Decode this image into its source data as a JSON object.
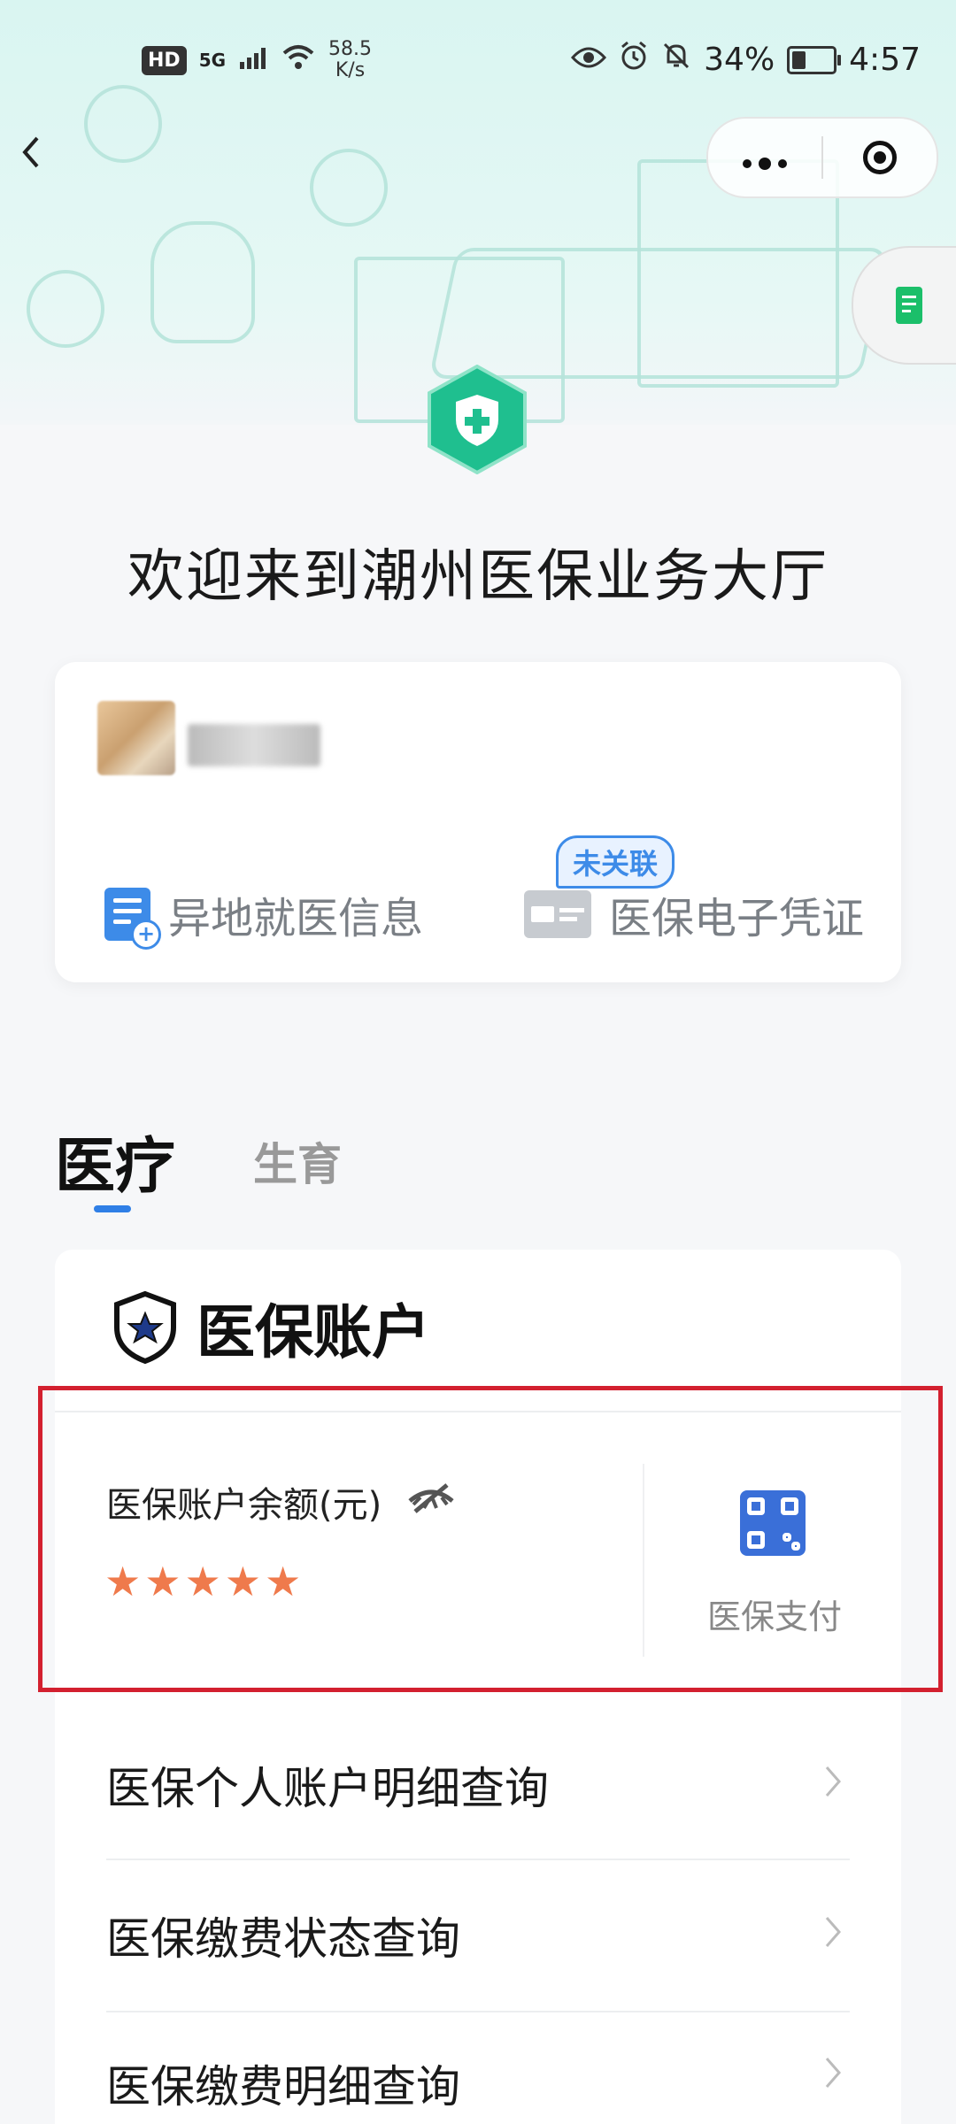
{
  "status_bar": {
    "hd": "HD",
    "net_type": "5G",
    "speed_value": "58.5",
    "speed_unit": "K/s",
    "battery": "34%",
    "time": "4:57",
    "battery_level": 0.34
  },
  "nav": {
    "back_icon": "chevron-left-icon",
    "more_icon": "more-dots-icon",
    "close_icon": "target-icon",
    "side_icon": "document-icon"
  },
  "welcome": "欢迎来到潮州医保业务大厅",
  "user_card": {
    "services": [
      {
        "label": "异地就医信息",
        "icon": "doc-plus-icon"
      },
      {
        "label": "医保电子凭证",
        "icon": "id-card-icon"
      }
    ],
    "badge": "未关联"
  },
  "tabs": [
    {
      "label": "医疗",
      "active": true
    },
    {
      "label": "生育",
      "active": false
    }
  ],
  "account": {
    "title": "医保账户",
    "balance_label": "医保账户余额(元)",
    "balance_masked": "★★★★★",
    "pay_label": "医保支付"
  },
  "menu_items": [
    {
      "label": "医保个人账户明细查询"
    },
    {
      "label": "医保缴费状态查询"
    },
    {
      "label": "医保缴费明细查询"
    }
  ],
  "colors": {
    "accent_green": "#1fbf8f",
    "accent_blue": "#2f7fe6",
    "highlight_red": "#d3202f",
    "star_orange": "#ef7a4c"
  }
}
